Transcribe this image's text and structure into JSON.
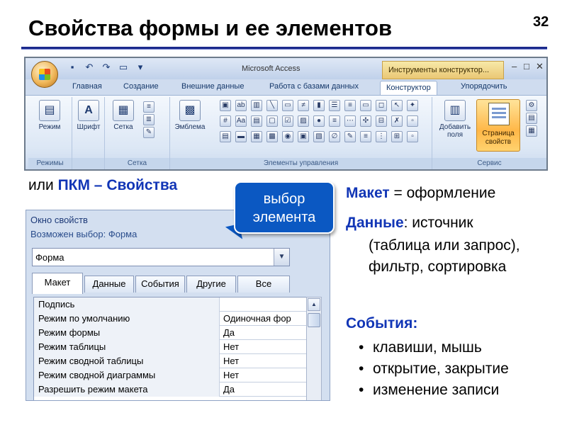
{
  "slide": {
    "title": "Свойства формы и ее элементов",
    "number": "32"
  },
  "ribbon": {
    "app_title": "Microsoft Access",
    "context_title": "Инструменты конструктор...",
    "tabs": [
      "Главная",
      "Создание",
      "Внешние данные",
      "Работа с базами данных",
      "Конструктор",
      "Упорядочить"
    ],
    "active_tab": "Конструктор",
    "groups": {
      "modes": {
        "label": "Режимы",
        "button": "Режим"
      },
      "font": {
        "button": "Шрифт"
      },
      "grid": {
        "label": "Сетка",
        "button": "Сетка"
      },
      "controls": {
        "label": "Элементы управления",
        "emblem": "Эмблема"
      },
      "service": {
        "label": "Сервис",
        "add_fields_1": "Добавить",
        "add_fields_2": "поля",
        "props_1": "Страница",
        "props_2": "свойств"
      }
    }
  },
  "left_text": {
    "prefix": "или ",
    "emph": "ПКМ – Свойства"
  },
  "callout": {
    "line1": "выбор",
    "line2": "элемента"
  },
  "property_sheet": {
    "title": "Окно свойств",
    "choice_label": "Возможен выбор:  Форма",
    "combo_value": "Форма",
    "tabs": [
      "Макет",
      "Данные",
      "События",
      "Другие",
      "Все"
    ],
    "active_tab": "Макет",
    "rows": [
      {
        "name": "Подпись",
        "value": ""
      },
      {
        "name": "Режим по умолчанию",
        "value": "Одиночная фор"
      },
      {
        "name": "Режим формы",
        "value": "Да"
      },
      {
        "name": "Режим таблицы",
        "value": "Нет"
      },
      {
        "name": "Режим сводной таблицы",
        "value": "Нет"
      },
      {
        "name": "Режим сводной диаграммы",
        "value": "Нет"
      },
      {
        "name": "Разрешить режим макета",
        "value": "Да"
      }
    ]
  },
  "right_text": {
    "layout_kw": "Макет",
    "layout_rest": " = оформление",
    "data_kw": "Данные",
    "data_rest": ": источник",
    "data_cont": "(таблица или запрос), фильтр, сортировка",
    "events_kw": "События:",
    "bullets": [
      "клавиши, мышь",
      "открытие, закрытие",
      "изменение записи"
    ]
  },
  "colors": {
    "accent_blue": "#1236b6",
    "callout_blue": "#0b58c2",
    "title_rule": "#1c2a8c"
  }
}
